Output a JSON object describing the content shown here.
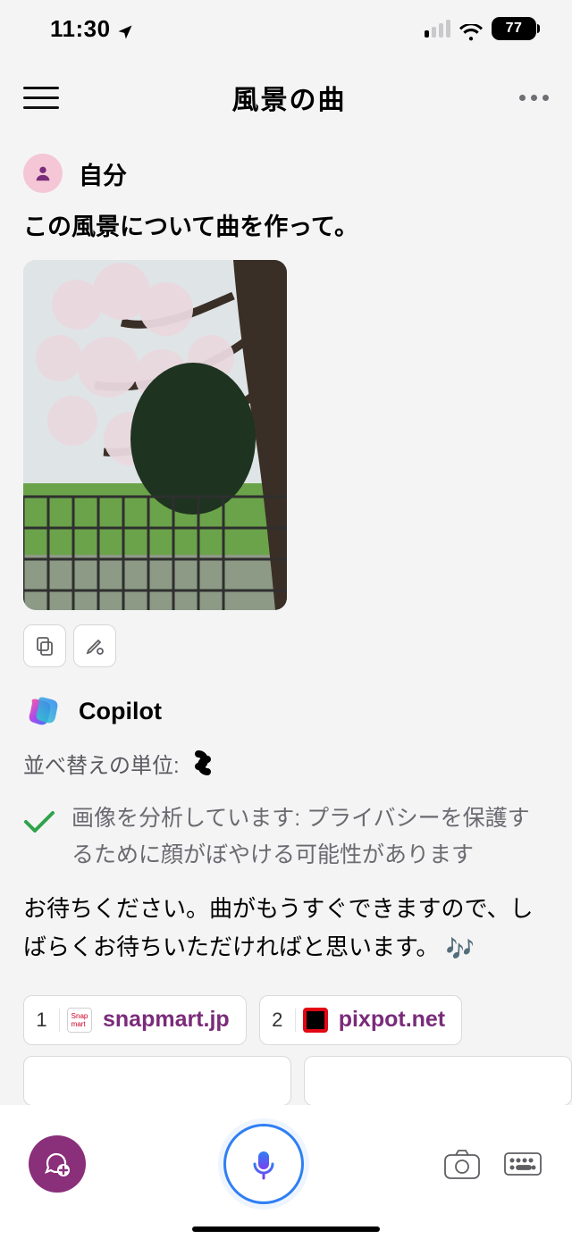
{
  "status": {
    "time": "11:30",
    "battery": "77"
  },
  "header": {
    "title": "風景の曲"
  },
  "user": {
    "name": "自分",
    "message": "この風景について曲を作って。"
  },
  "actions": {
    "copy": "copy-icon",
    "edit": "edit-icon"
  },
  "assistant": {
    "name": "Copilot",
    "sort_label": "並べ替えの単位:",
    "analysis": "画像を分析しています: プライバシーを保護するために顔がぼやける可能性があります",
    "wait": "お待ちください。曲がもうすぐできますので、しばらくお待ちいただければと思います。",
    "notes_emoji": "🎶"
  },
  "sources": [
    {
      "index": "1",
      "domain": "snapmart.jp"
    },
    {
      "index": "2",
      "domain": "pixpot.net"
    }
  ]
}
